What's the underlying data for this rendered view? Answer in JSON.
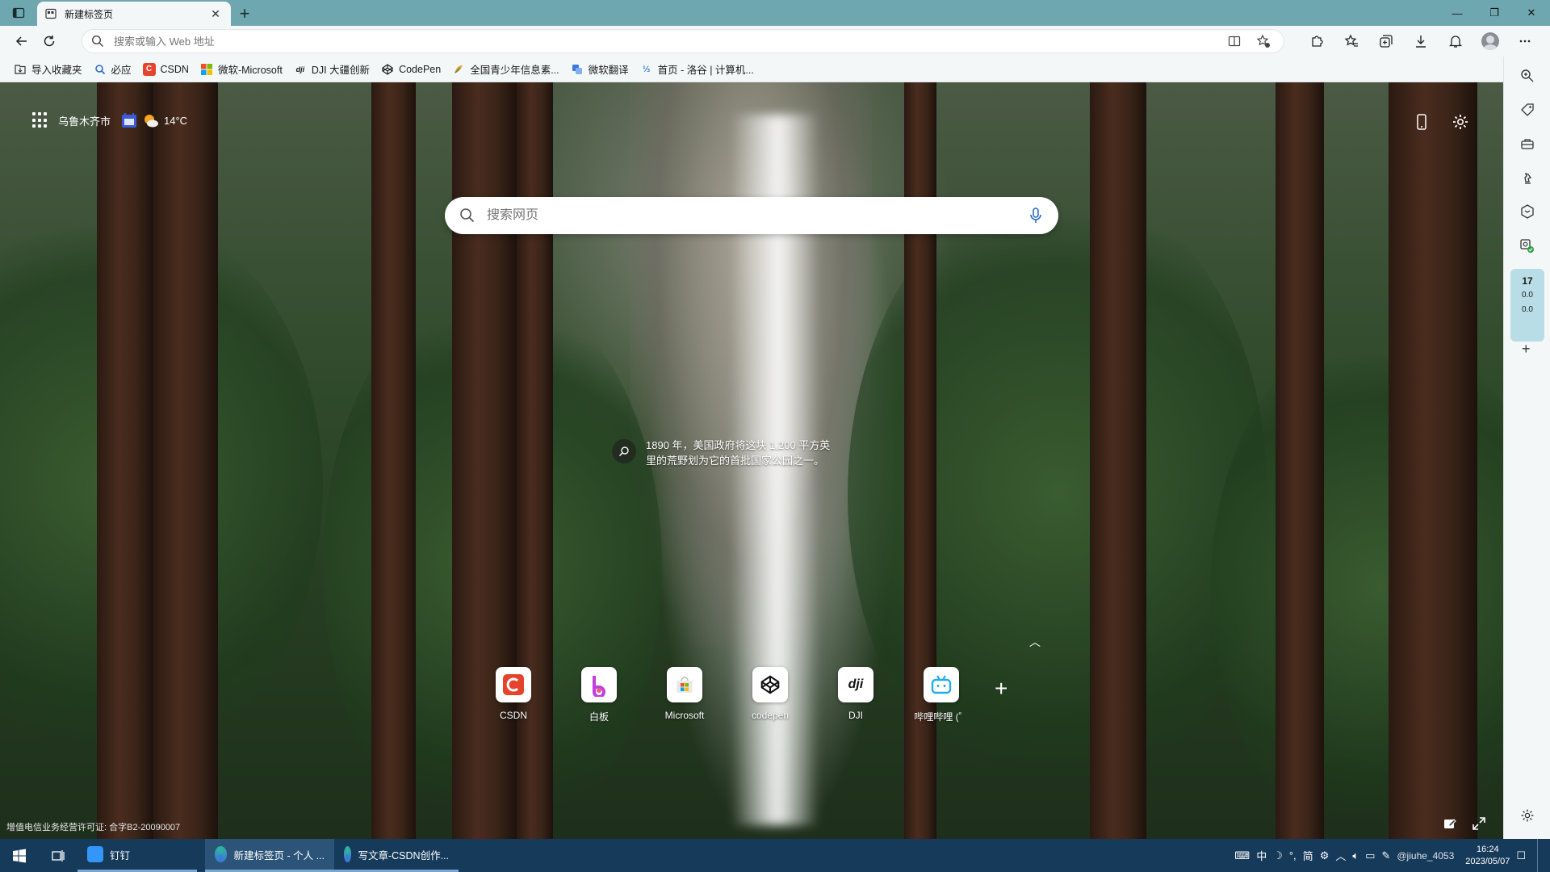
{
  "browser": {
    "tab_title": "新建标签页",
    "address_placeholder": "搜索或输入 Web 地址"
  },
  "favorites": [
    {
      "label": "导入收藏夹",
      "icon": "import-favorites-icon",
      "color": "#333333"
    },
    {
      "label": "必应",
      "icon": "bing-search-icon",
      "color": "#2b6cd1"
    },
    {
      "label": "CSDN",
      "icon": "csdn-icon",
      "color": "#e6432d"
    },
    {
      "label": "微软-Microsoft",
      "icon": "microsoft-icon",
      "color": "#f25022"
    },
    {
      "label": "DJI 大疆创新",
      "icon": "dji-icon",
      "color": "#111111"
    },
    {
      "label": "CodePen",
      "icon": "codepen-icon",
      "color": "#111111"
    },
    {
      "label": "全国青少年信息素...",
      "icon": "youth-info-icon",
      "color": "#e8a23a"
    },
    {
      "label": "微软翻译",
      "icon": "translator-icon",
      "color": "#3b78d8"
    },
    {
      "label": "首页 - 洛谷 | 计算机...",
      "icon": "luogu-icon",
      "color": "#3b78d8"
    }
  ],
  "newtab": {
    "location": "乌鲁木齐市",
    "weather_temp": "14°C",
    "search_placeholder": "搜索网页",
    "caption_line1": "1890 年，美国政府将这块 1,200 平方英",
    "caption_line2": "里的荒野划为它的首批国家公园之一。",
    "quick_links": [
      {
        "label": "CSDN",
        "icon": "csdn-icon",
        "color": "#e6432d"
      },
      {
        "label": "白板",
        "icon": "whiteboard-icon",
        "color": "#c43de0"
      },
      {
        "label": "Microsoft",
        "icon": "microsoft-store-icon",
        "color": "#7fba00"
      },
      {
        "label": "codepen",
        "icon": "codepen-icon",
        "color": "#111111"
      },
      {
        "label": "DJI",
        "icon": "dji-icon",
        "color": "#111111"
      },
      {
        "label": "哔哩哔哩 (゜",
        "icon": "bilibili-icon",
        "color": "#23ade5"
      }
    ],
    "license": "增值电信业务经营许可证: 合字B2-20090007"
  },
  "sidebar": {
    "speed_top": "17",
    "speed_up": "0.0",
    "speed_down": "0.0"
  },
  "taskbar": {
    "apps": [
      {
        "label": "钉钉",
        "icon": "dingtalk-icon",
        "color": "#3296fa",
        "active": false
      },
      {
        "label": "新建标签页 - 个人 ...",
        "icon": "edge-icon",
        "color": "#2fb3a0",
        "active": true
      },
      {
        "label": "写文章-CSDN创作...",
        "icon": "edge-icon",
        "color": "#2fb3a0",
        "active": false
      }
    ],
    "tray_ime1": "中",
    "tray_ime2": "简",
    "tray_text": "@jiuhe_4053",
    "time": "16:24",
    "date": "2023/05/07"
  }
}
